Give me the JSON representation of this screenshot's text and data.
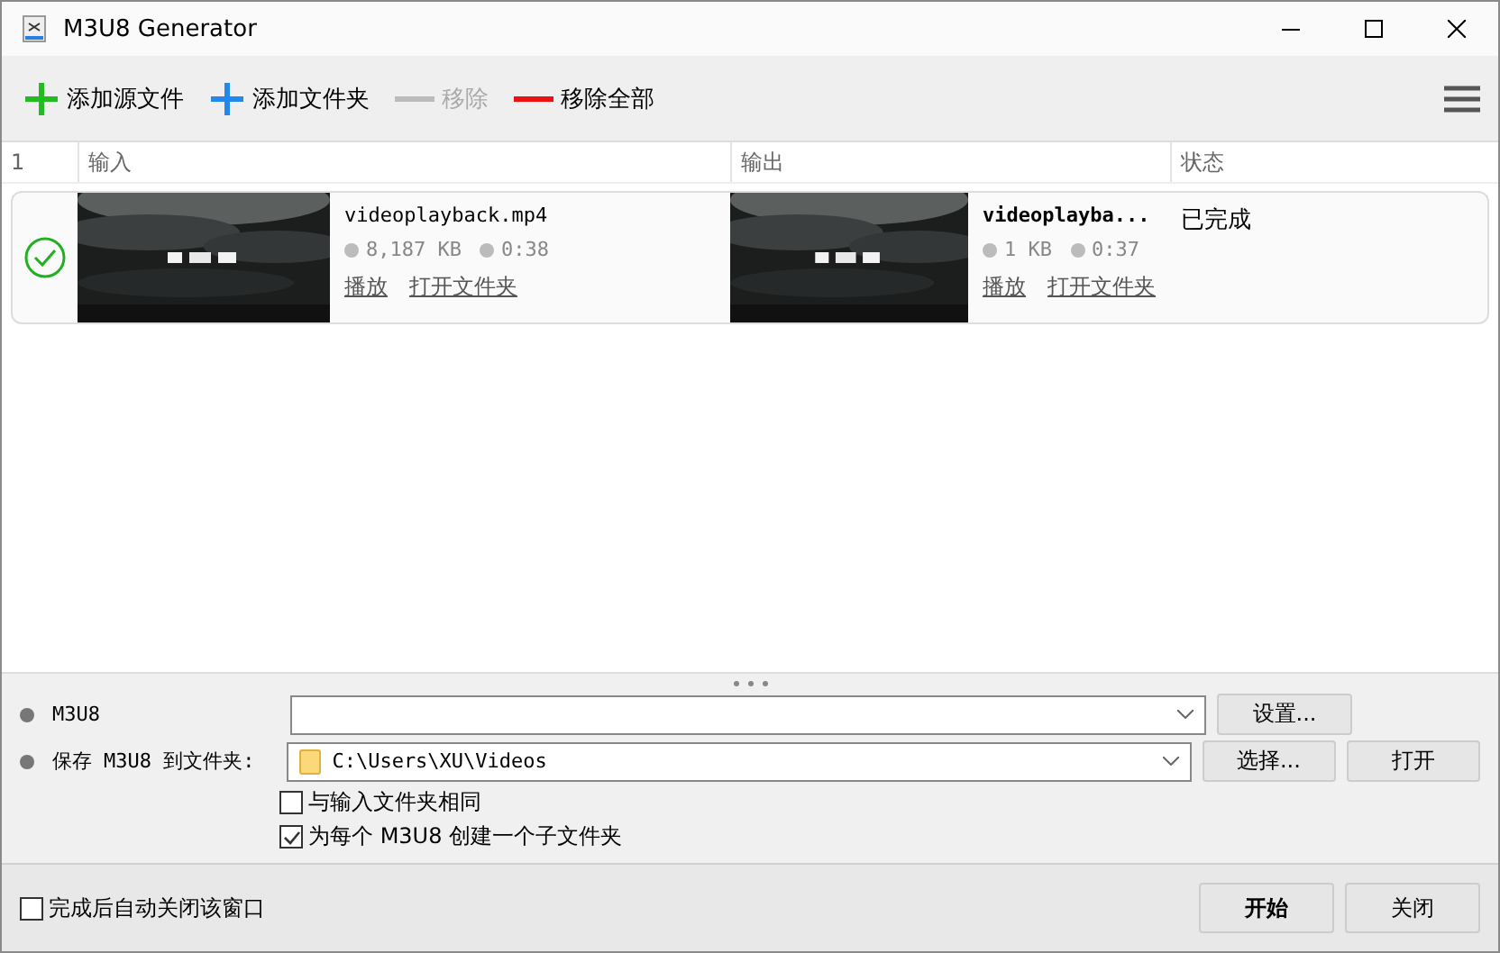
{
  "window": {
    "title": "M3U8 Generator"
  },
  "toolbar": {
    "buttons": [
      {
        "label": "添加源文件",
        "kind": "add",
        "color": "#22bb22",
        "disabled": false
      },
      {
        "label": "添加文件夹",
        "kind": "add",
        "color": "#2288ee",
        "disabled": false
      },
      {
        "label": "移除",
        "kind": "remove",
        "color": "#bbbbbb",
        "disabled": true
      },
      {
        "label": "移除全部",
        "kind": "remove",
        "color": "#ee1111",
        "disabled": false
      }
    ]
  },
  "table": {
    "count": "1",
    "columns": [
      "输入",
      "输出",
      "状态"
    ],
    "rows": [
      {
        "done": true,
        "input": {
          "name": "videoplayback.mp4",
          "size": "8,187 KB",
          "duration": "0:38",
          "links": [
            "播放",
            "打开文件夹"
          ]
        },
        "output": {
          "name": "videoplayba...",
          "size": "1 KB",
          "duration": "0:37",
          "links": [
            "播放",
            "打开文件夹"
          ]
        },
        "status": "已完成"
      }
    ]
  },
  "settings": {
    "rows": [
      {
        "label": "M3U8",
        "value": "",
        "buttons": [
          "设置..."
        ]
      },
      {
        "label": "保存 M3U8 到文件夹:",
        "value": "C:\\Users\\XU\\Videos",
        "folder": true,
        "buttons": [
          "选择...",
          "打开"
        ]
      }
    ],
    "checkboxes": [
      {
        "label": "与输入文件夹相同",
        "checked": false
      },
      {
        "label": "为每个 M3U8 创建一个子文件夹",
        "checked": true
      }
    ]
  },
  "footer": {
    "checkbox": {
      "label": "完成后自动关闭该窗口",
      "checked": false
    },
    "buttons": [
      {
        "label": "开始",
        "primary": true
      },
      {
        "label": "关闭",
        "primary": false
      }
    ]
  }
}
